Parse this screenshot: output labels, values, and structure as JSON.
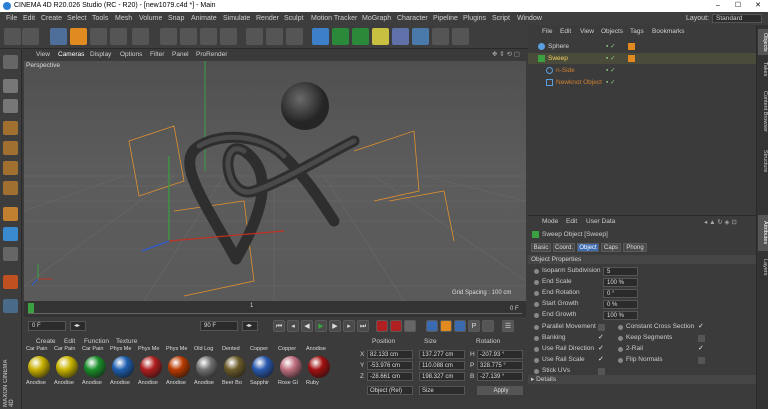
{
  "titlebar": {
    "title": "CINEMA 4D R20.026 Studio (RC - R20) - [new1079.c4d *] - Main",
    "min": "–",
    "max": "☐",
    "close": "✕"
  },
  "menubar": {
    "items": [
      "File",
      "Edit",
      "Create",
      "Select",
      "Tools",
      "Mesh",
      "Volume",
      "Snap",
      "Animate",
      "Simulate",
      "Render",
      "Sculpt",
      "Motion Tracker",
      "MoGraph",
      "Character",
      "Pipeline",
      "Plugins",
      "Script",
      "Window"
    ],
    "layout_label": "Layout:",
    "layout_value": "Standard"
  },
  "viewport": {
    "menu": [
      "View",
      "Cameras",
      "Display",
      "Options",
      "Filter",
      "Panel",
      "ProRender"
    ],
    "camera_label": "Perspective",
    "grid_spacing": "Grid Spacing : 100 cm"
  },
  "timeline": {
    "start_frame": "0",
    "mid_tick": "1",
    "end_frame": "0 F",
    "range_start": "0 F",
    "range_end": "90 F",
    "current": "0 F",
    "scale": "90 F"
  },
  "materials": {
    "menu": [
      "Create",
      "Edit",
      "Function",
      "Texture"
    ],
    "items": [
      {
        "top": "Car Pain",
        "bottom": "Anodise",
        "color": "#c8b000"
      },
      {
        "top": "Car Pain",
        "bottom": "Anodise",
        "color": "#c9b400"
      },
      {
        "top": "Car Pain",
        "bottom": "Anodise",
        "color": "#1a8f2a"
      },
      {
        "top": "Phys Me",
        "bottom": "Anodise",
        "color": "#1e5fb0"
      },
      {
        "top": "Phys Me",
        "bottom": "Anodise",
        "color": "#b01e1e"
      },
      {
        "top": "Phys Me",
        "bottom": "Anodise",
        "color": "#b83a00"
      },
      {
        "top": "Old Log",
        "bottom": "Anodise",
        "color": "#707070"
      },
      {
        "top": "Dented",
        "bottom": "Beer Bo",
        "color": "#6b5c2a"
      },
      {
        "top": "Copper",
        "bottom": "Sapphir",
        "color": "#2a5ab0"
      },
      {
        "top": "Copper",
        "bottom": "Rose Gl",
        "color": "#c07080"
      },
      {
        "top": "Anodise",
        "bottom": "Ruby",
        "color": "#a01010"
      }
    ]
  },
  "coords": {
    "headers": [
      "Position",
      "Size",
      "Rotation"
    ],
    "rows": [
      {
        "axis": "X",
        "pos": "82.133 cm",
        "size": "137.277 cm",
        "rlabel": "H",
        "rot": "-207.93 °"
      },
      {
        "axis": "Y",
        "pos": "-53.976 cm",
        "size": "110.088 cm",
        "rlabel": "P",
        "rot": "328.775 °"
      },
      {
        "axis": "Z",
        "pos": "-28.661 cm",
        "size": "198.327 cm",
        "rlabel": "B",
        "rot": "-27.139 °"
      }
    ],
    "mode": "Object (Rel)",
    "size_mode": "Size",
    "apply": "Apply"
  },
  "objects": {
    "menu": [
      "File",
      "Edit",
      "View",
      "Objects",
      "Tags",
      "Bookmarks"
    ],
    "items": [
      {
        "name": "Sphere",
        "indent": 0,
        "color": "#ddd"
      },
      {
        "name": "Sweep",
        "indent": 0,
        "color": "#f0d060"
      },
      {
        "name": "n-Side",
        "indent": 1,
        "color": "#d08030"
      },
      {
        "name": "Newknot Object",
        "indent": 1,
        "color": "#d08030"
      }
    ]
  },
  "attributes": {
    "menu": [
      "Mode",
      "Edit",
      "User Data"
    ],
    "object_title": "Sweep Object [Sweep]",
    "tabs": [
      "Basic",
      "Coord.",
      "Object",
      "Caps",
      "Phong"
    ],
    "active_tab": "Object",
    "section": "Object Properties",
    "fields": [
      {
        "label": "Isoparm Subdivision",
        "value": "5"
      },
      {
        "label": "End Scale",
        "value": "100 %"
      },
      {
        "label": "End Rotation",
        "value": "0 °"
      },
      {
        "label": "Start Growth",
        "value": "0 %"
      },
      {
        "label": "End Growth",
        "value": "100 %"
      }
    ],
    "checks_left": [
      {
        "label": "Parallel Movement",
        "checked": false
      },
      {
        "label": "Banking",
        "checked": true
      },
      {
        "label": "Use Rail Direction",
        "checked": true
      },
      {
        "label": "Use Rail Scale",
        "checked": true
      },
      {
        "label": "Stick UVs",
        "checked": false
      }
    ],
    "checks_right": [
      {
        "label": "Constant Cross Section",
        "checked": true
      },
      {
        "label": "Keep Segments",
        "checked": false
      },
      {
        "label": "2-Rail",
        "checked": true
      },
      {
        "label": "Flip Normals",
        "checked": false
      }
    ],
    "details": "Details"
  },
  "sidetabs": [
    "Objects",
    "Takes",
    "Content Browser",
    "Structure",
    "Attributes",
    "Layers"
  ],
  "brand": "MAXON CINEMA 4D"
}
